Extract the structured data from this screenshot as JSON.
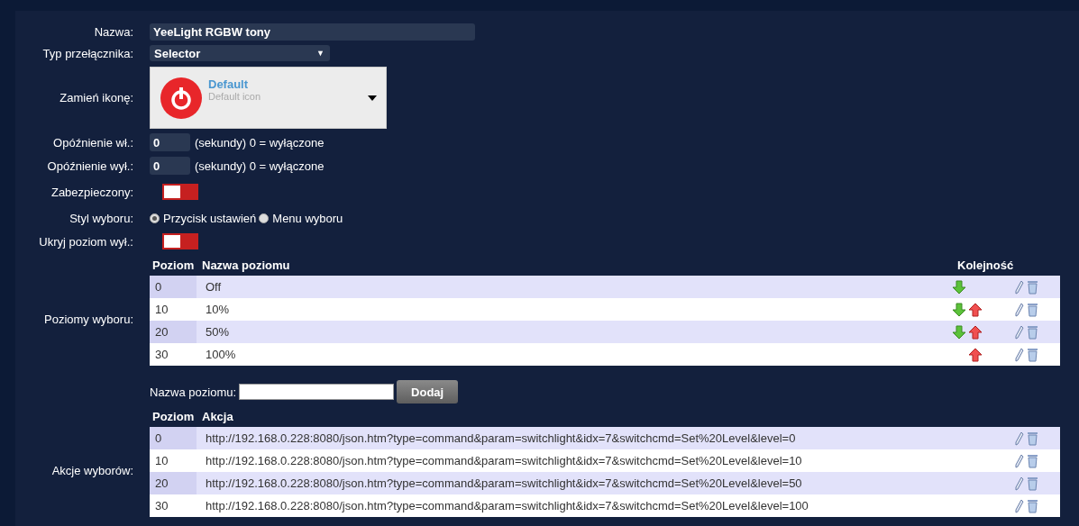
{
  "name": {
    "label": "Nazwa:",
    "value": "YeeLight RGBW tony"
  },
  "switch_type": {
    "label": "Typ przełącznika:",
    "value": "Selector",
    "caret": "▼"
  },
  "icon": {
    "label": "Zamień ikonę:",
    "title": "Default",
    "subtitle": "Default icon"
  },
  "delays": [
    {
      "label": "Opóźnienie wł.:",
      "value": "0",
      "hint": "(sekundy) 0 = wyłączone"
    },
    {
      "label": "Opóźnienie wył.:",
      "value": "0",
      "hint": "(sekundy) 0 = wyłączone"
    }
  ],
  "protected": {
    "label": "Zabezpieczony:",
    "on": false
  },
  "selector_style": {
    "label": "Styl wyboru:",
    "options": [
      {
        "label": "Przycisk ustawień",
        "selected": true
      },
      {
        "label": "Menu wyboru",
        "selected": false
      }
    ]
  },
  "hide_off": {
    "label": "Ukryj poziom wył.:",
    "on": false
  },
  "levels": {
    "label": "Poziomy wyboru:",
    "columns": [
      "Poziom",
      "Nazwa poziomu",
      "Kolejność"
    ],
    "rows": [
      {
        "level": "0",
        "name": "Off",
        "down": true,
        "up": false
      },
      {
        "level": "10",
        "name": "10%",
        "down": true,
        "up": true
      },
      {
        "level": "20",
        "name": "50%",
        "down": true,
        "up": true
      },
      {
        "level": "30",
        "name": "100%",
        "down": false,
        "up": true
      }
    ]
  },
  "add_level": {
    "label": "Nazwa poziomu:",
    "button": "Dodaj"
  },
  "actions": {
    "label": "Akcje wyborów:",
    "columns": [
      "Poziom",
      "Akcja"
    ],
    "rows": [
      {
        "level": "0",
        "action": "http://192.168.0.228:8080/json.htm?type=command&param=switchlight&idx=7&switchcmd=Set%20Level&level=0"
      },
      {
        "level": "10",
        "action": "http://192.168.0.228:8080/json.htm?type=command&param=switchlight&idx=7&switchcmd=Set%20Level&level=10"
      },
      {
        "level": "20",
        "action": "http://192.168.0.228:8080/json.htm?type=command&param=switchlight&idx=7&switchcmd=Set%20Level&level=50"
      },
      {
        "level": "30",
        "action": "http://192.168.0.228:8080/json.htm?type=command&param=switchlight&idx=7&switchcmd=Set%20Level&level=100"
      }
    ]
  }
}
